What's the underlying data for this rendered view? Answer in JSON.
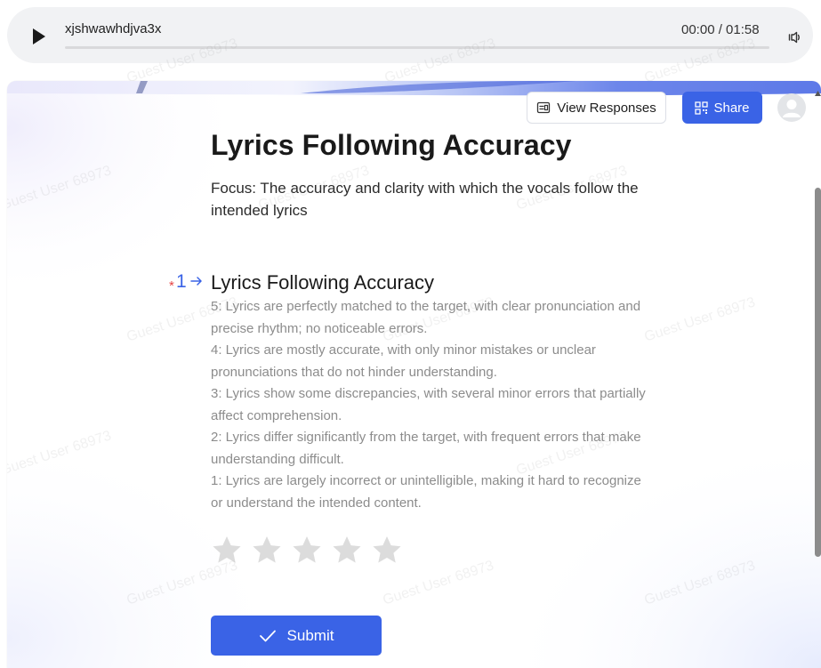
{
  "player": {
    "track_name": "xjshwawhdjva3x",
    "time_readout": "00:00 / 01:58",
    "progress_percent": 0
  },
  "toolbar": {
    "view_responses_label": "View Responses",
    "share_label": "Share"
  },
  "survey": {
    "title": "Lyrics Following Accuracy",
    "description": "Focus: The accuracy and clarity with which the vocals follow the intended lyrics"
  },
  "question": {
    "required_mark": "*",
    "number": "1",
    "title": "Lyrics Following Accuracy",
    "description_lines": [
      "5: Lyrics are perfectly matched to the target, with clear pronunciation and precise rhythm; no noticeable errors.",
      "4: Lyrics are mostly accurate, with only minor mistakes or unclear pronunciations that do not hinder understanding.",
      "3: Lyrics show some discrepancies, with several minor errors that partially affect comprehension.",
      "2: Lyrics differ significantly from the target, with frequent errors that make understanding difficult.",
      "1: Lyrics are largely incorrect or unintelligible, making it hard to recognize or understand the intended content."
    ],
    "rating_max": 5,
    "rating_value": 0
  },
  "submit_label": "Submit",
  "watermark_text": "Guest User 68973",
  "colors": {
    "accent": "#3a63e6",
    "star_empty": "#dcdcdc",
    "required": "#e54545",
    "description_text": "#8c8c8c"
  }
}
